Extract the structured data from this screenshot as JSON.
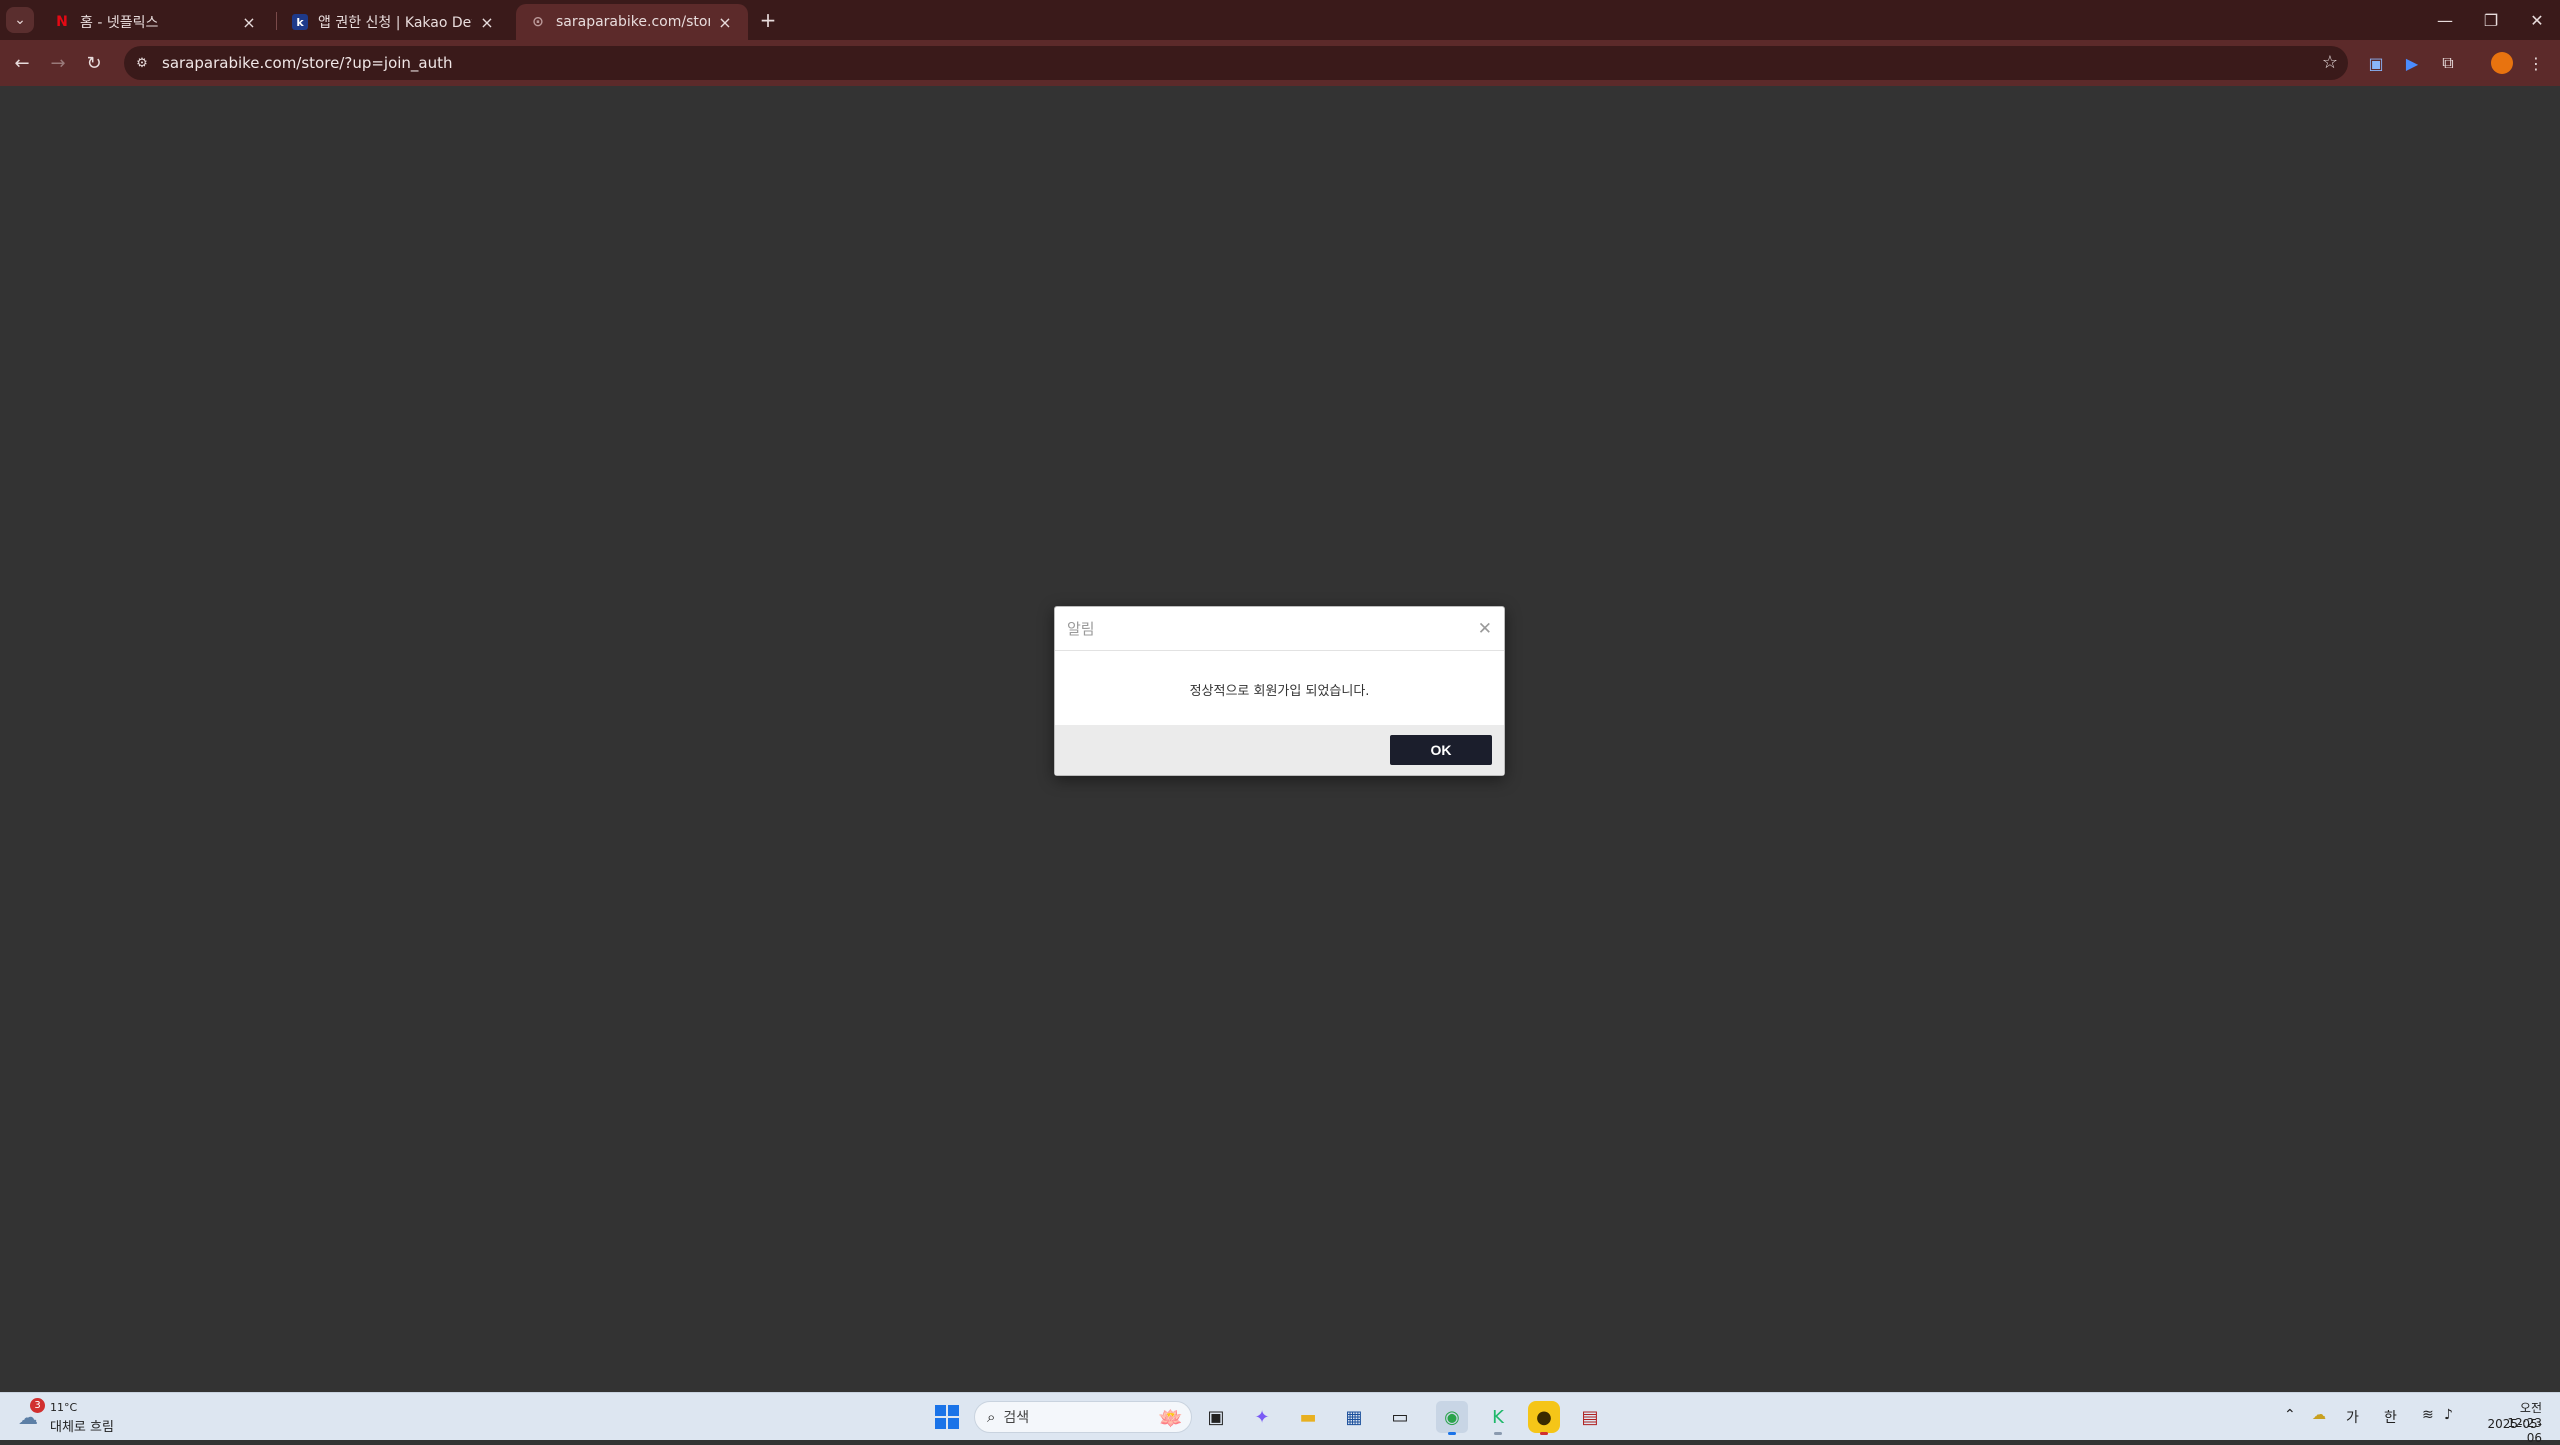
{
  "browser": {
    "tabs": [
      {
        "title": "홈 - 넷플릭스",
        "favicon": "N",
        "active": false
      },
      {
        "title": "앱 권한 신청 | Kakao Develop",
        "favicon": "k",
        "active": false
      },
      {
        "title": "saraparabike.com/store/?up=jo",
        "favicon": "⊙",
        "active": true
      }
    ],
    "url": "saraparabike.com/store/?up=join_auth",
    "colors": {
      "frame": "#3a1a1a",
      "toolbar": "#5c2a2a",
      "page": "#333333"
    }
  },
  "dialog": {
    "title": "알림",
    "message": "정상적으로 회원가입 되었습니다.",
    "ok_label": "OK"
  },
  "taskbar": {
    "weather_temp": "11°C",
    "weather_desc": "대체로 흐림",
    "weather_badge": "3",
    "search_placeholder": "검색",
    "ime_mode": "가",
    "ime_lang": "한",
    "time": "오전 12:23",
    "date": "2025-05-06"
  }
}
